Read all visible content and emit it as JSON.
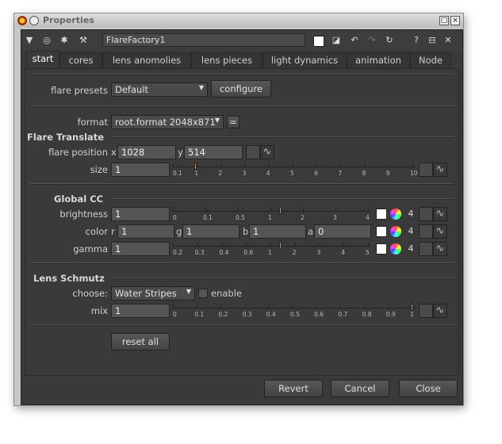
{
  "window": {
    "title": "Properties"
  },
  "node": {
    "name": "FlareFactory1"
  },
  "tabs": [
    "start",
    "cores",
    "lens anomolies",
    "lens pieces",
    "light dynamics",
    "animation",
    "Node"
  ],
  "presets": {
    "label": "flare presets",
    "value": "Default",
    "configure": "configure"
  },
  "format": {
    "label": "format",
    "value": "root.format 2048x871",
    "eq": "="
  },
  "translate": {
    "header": "Flare Translate",
    "pos_label": "flare position",
    "x_label": "x",
    "x": "1028",
    "y_label": "y",
    "y": "514",
    "size_label": "size",
    "size": "1",
    "size_ticks": [
      "0.1",
      "1",
      "2",
      "3",
      "4",
      "5",
      "6",
      "7",
      "8",
      "9",
      "10"
    ],
    "size_value": 1
  },
  "cc": {
    "header": "Global CC",
    "brightness_label": "brightness",
    "brightness": "1",
    "brightness_ticks": [
      "0",
      "0.1",
      "0.5",
      "1",
      "2",
      "3",
      "4"
    ],
    "color_label": "color",
    "r_label": "r",
    "r": "1",
    "g_label": "g",
    "g": "1",
    "b_label": "b",
    "b": "1",
    "a_label": "a",
    "a": "0",
    "gamma_label": "gamma",
    "gamma": "1",
    "gamma_ticks": [
      "0.2",
      "0.3",
      "0.4",
      "0.6",
      "1",
      "2",
      "3",
      "4",
      "5"
    ],
    "channels": "4"
  },
  "schmutz": {
    "header": "Lens Schmutz",
    "choose_label": "choose:",
    "choose": "Water Stripes",
    "enable": "enable",
    "mix_label": "mix",
    "mix": "1",
    "mix_ticks": [
      "0",
      "0.1",
      "0.2",
      "0.3",
      "0.4",
      "0.5",
      "0.6",
      "0.7",
      "0.8",
      "0.9",
      "1"
    ],
    "mix_value": 1
  },
  "reset": "reset all",
  "footer": {
    "revert": "Revert",
    "cancel": "Cancel",
    "close": "Close"
  },
  "icons": {
    "toolbar": [
      "triangle-icon",
      "circle-icon",
      "gear-icon",
      "wrench-icon",
      "square-icon",
      "diagonal-icon",
      "undo-icon",
      "redo-icon",
      "refresh-icon",
      "help-icon",
      "float-icon",
      "close-icon"
    ]
  },
  "colors": {
    "knob": "#c8a040",
    "panel": "#3a3a3a"
  }
}
